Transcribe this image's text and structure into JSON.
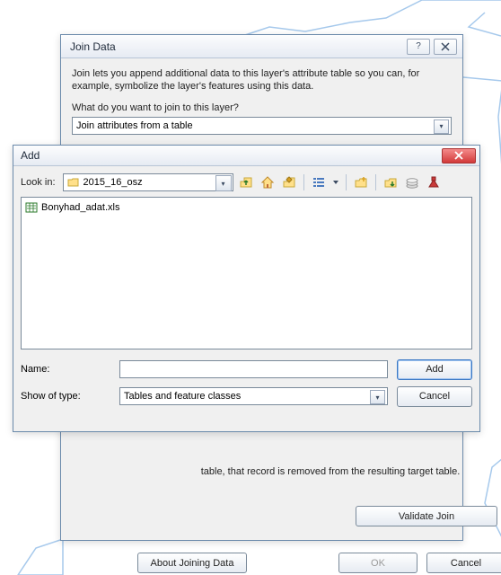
{
  "bg": {
    "stroke": "#a6c9ec",
    "fill": "#ffffff"
  },
  "join": {
    "title": "Join Data",
    "desc": "Join lets you append additional data to this layer's attribute table so you can, for example, symbolize the layer's features using this data.",
    "q1": "What do you want to join to this layer?",
    "q1_value": "Join attributes from a table",
    "hidden_tail": "table, that record is removed from the resulting target table.",
    "validate": "Validate Join",
    "about": "About Joining Data",
    "ok": "OK",
    "cancel": "Cancel",
    "help_glyph": "?"
  },
  "add": {
    "title": "Add",
    "lookin_label": "Look in:",
    "lookin_value": "2015_16_osz",
    "file_name": "Bonyhad_adat.xls",
    "name_label": "Name:",
    "name_value": "",
    "type_label": "Show of type:",
    "type_value": "Tables and feature classes",
    "add_btn": "Add",
    "cancel_btn": "Cancel",
    "icons": {
      "up": "up-level-icon",
      "home": "home-icon",
      "bookmark": "bookmark-icon",
      "views": "list-view-icon",
      "newfolder": "new-folder-icon",
      "connect": "connect-folder-icon",
      "disconnect": "disconnect-folder-icon",
      "gis": "gis-server-icon"
    }
  }
}
